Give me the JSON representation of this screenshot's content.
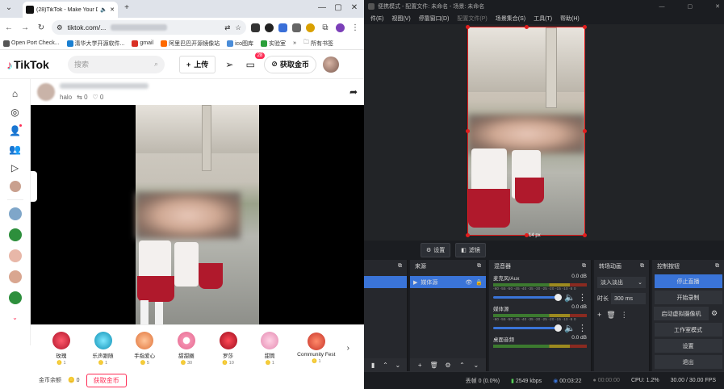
{
  "browser": {
    "tab_title": "(28)TikTok - Make Your D...",
    "url": "tiktok.com/...",
    "bookmarks": [
      {
        "label": "Open Port Check...",
        "color": "#555"
      },
      {
        "label": "清华大学开源软件...",
        "color": "#1a7fd1"
      },
      {
        "label": "gmail",
        "color": "#d93025"
      },
      {
        "label": "阿里巴巴开源镜像站",
        "color": "#ff6a00"
      },
      {
        "label": "ico图库",
        "color": "#4a8cd8"
      },
      {
        "label": "实验室",
        "color": "#2b9f3a"
      },
      {
        "label": "所有书签",
        "color": "#888"
      }
    ]
  },
  "tiktok": {
    "logo": "TikTok",
    "search_placeholder": "搜索",
    "upload_label": "上传",
    "inbox_badge": "28",
    "coin_label": "获取金币",
    "post_meta_tag": "halo",
    "post_reposts": "0",
    "post_likes": "0",
    "gifts": [
      {
        "name": "玫瑰",
        "cost": "1",
        "color": "#d62a3c"
      },
      {
        "name": "乐声跟随",
        "cost": "1",
        "color": "#1fb3d6"
      },
      {
        "name": "手指爱心",
        "cost": "5",
        "color": "#f39a5c"
      },
      {
        "name": "甜甜圈",
        "cost": "30",
        "color": "#f07a9e"
      },
      {
        "name": "罗莎",
        "cost": "10",
        "color": "#c8202e"
      },
      {
        "name": "甜筒",
        "cost": "1",
        "color": "#f0a6c6"
      },
      {
        "name": "Community Fest",
        "cost": "1",
        "color": "#e24b3b"
      }
    ],
    "balance_label": "金币余额",
    "balance_value": "0",
    "get_coin_button": "获取金币"
  },
  "obs": {
    "title": "便携模式 - 配置文件: 未命名 - 场景: 未命名",
    "menu": [
      "件(E)",
      "视图(V)",
      "停靠窗口(D)",
      "配置文件(P)",
      "场景集合(S)",
      "工具(T)",
      "帮助(H)"
    ],
    "canvas_label": "14 px",
    "settings_btn": "设置",
    "filter_btn": "滤镜",
    "sources_title": "来源",
    "source_item": "媒体源",
    "mixer_title": "混音器",
    "mixer_channels": [
      {
        "name": "麦克风/Aux",
        "db": "0.0 dB"
      },
      {
        "name": "媒体源",
        "db": "0.0 dB"
      },
      {
        "name": "桌面音频",
        "db": "0.0 dB"
      }
    ],
    "meter_scale": "-60 -55 -50 -45 -40 -35 -30 -25 -20 -15 -10 -5 0",
    "transition_title": "转场动画",
    "transition_value": "淡入淡出",
    "duration_label": "时长",
    "duration_value": "300 ms",
    "controls_title": "控制按钮",
    "controls": [
      "停止直播",
      "开始录制",
      "启动虚拟摄像机",
      "工作室模式",
      "设置",
      "退出"
    ],
    "status": {
      "dropped": "丢帧 0 (0.0%)",
      "bitrate": "2549 kbps",
      "live_time": "00:03:22",
      "rec_time": "00:00:00",
      "cpu": "CPU: 1.2%",
      "fps": "30.00 / 30.00 FPS"
    },
    "colors": {
      "accent": "#3a74d8",
      "record": "#e21c1c"
    }
  }
}
